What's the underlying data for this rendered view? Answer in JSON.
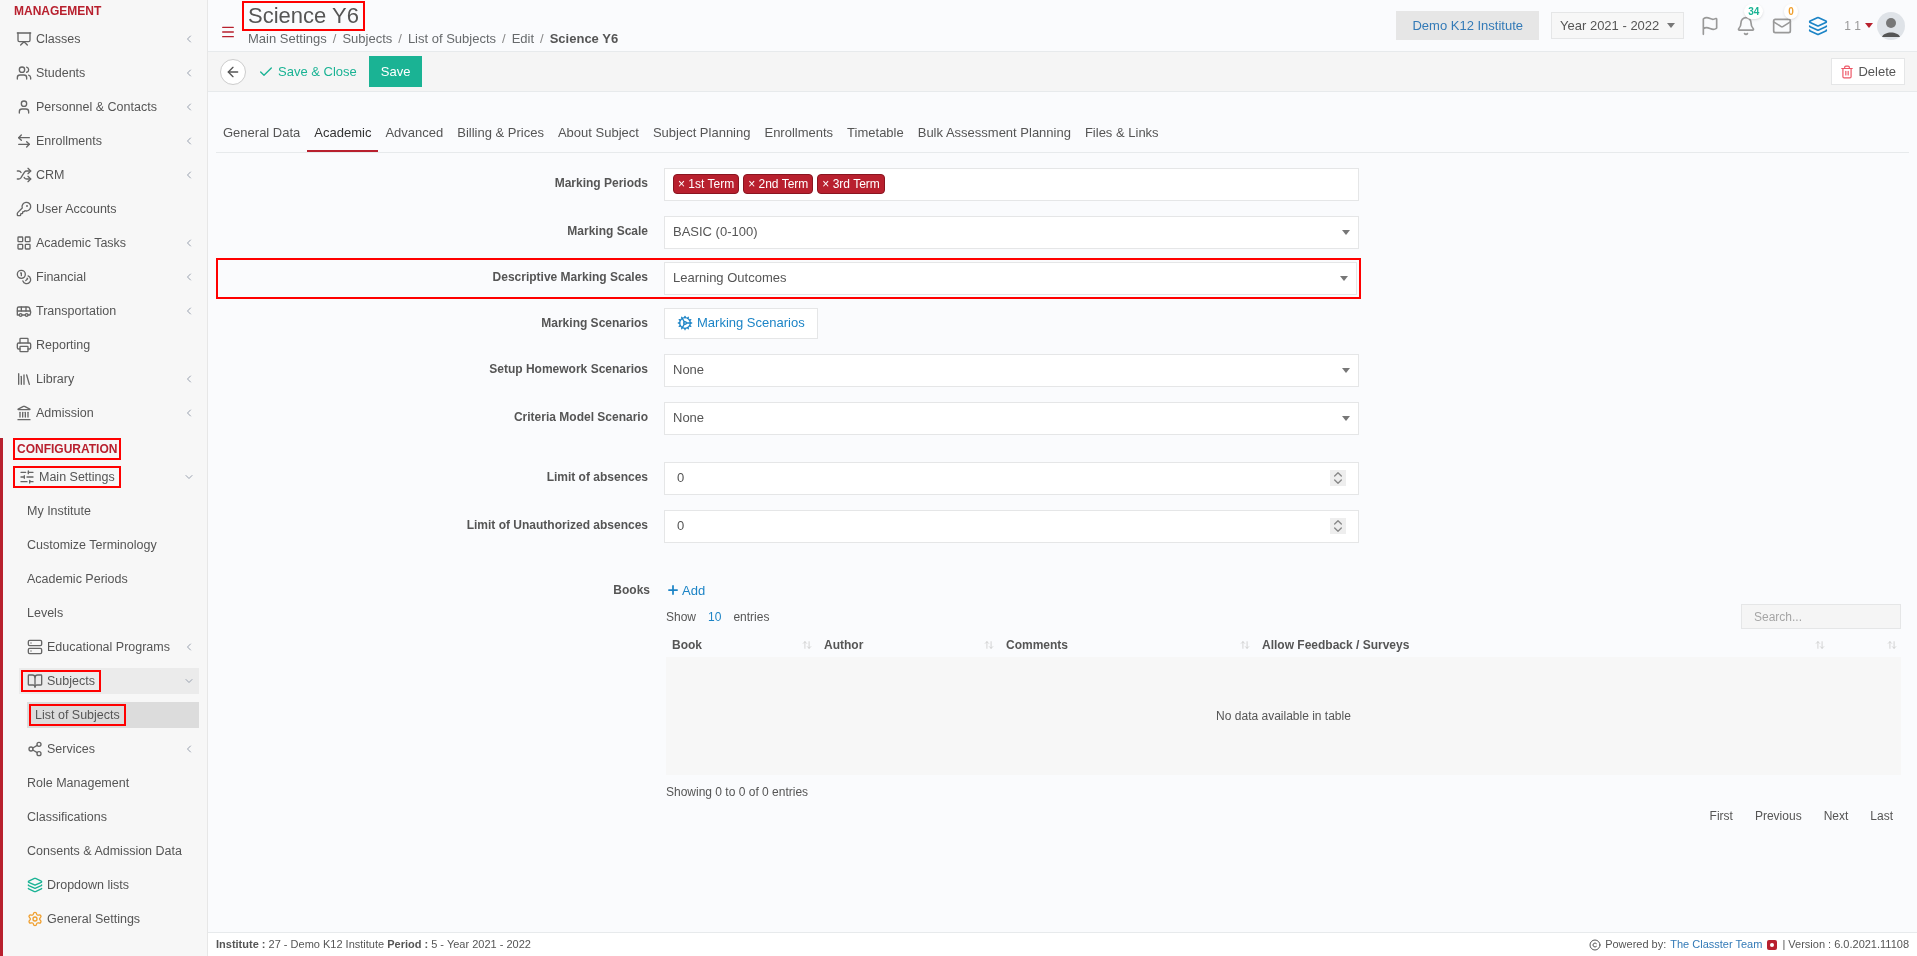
{
  "sidebar": {
    "sections": [
      {
        "heading": "MANAGEMENT",
        "highlighted": false,
        "items": [
          {
            "label": "Classes",
            "has_submenu": true,
            "expanded": false,
            "highlighted": false,
            "selected": false
          },
          {
            "label": "Students",
            "has_submenu": true,
            "expanded": false,
            "highlighted": false,
            "selected": false
          },
          {
            "label": "Personnel & Contacts",
            "has_submenu": true,
            "expanded": false,
            "highlighted": false,
            "selected": false
          },
          {
            "label": "Enrollments",
            "has_submenu": true,
            "expanded": false,
            "highlighted": false,
            "selected": false
          },
          {
            "label": "CRM",
            "has_submenu": true,
            "expanded": false,
            "highlighted": false,
            "selected": false
          },
          {
            "label": "User Accounts",
            "has_submenu": false,
            "highlighted": false,
            "selected": false
          },
          {
            "label": "Academic Tasks",
            "has_submenu": true,
            "expanded": false,
            "highlighted": false,
            "selected": false
          },
          {
            "label": "Financial",
            "has_submenu": true,
            "expanded": false,
            "highlighted": false,
            "selected": false
          },
          {
            "label": "Transportation",
            "has_submenu": true,
            "expanded": false,
            "highlighted": false,
            "selected": false
          },
          {
            "label": "Reporting",
            "has_submenu": false,
            "highlighted": false,
            "selected": false
          },
          {
            "label": "Library",
            "has_submenu": true,
            "expanded": false,
            "highlighted": false,
            "selected": false
          },
          {
            "label": "Admission",
            "has_submenu": true,
            "expanded": false,
            "highlighted": false,
            "selected": false
          }
        ]
      },
      {
        "heading": "CONFIGURATION",
        "highlighted": true,
        "items": [
          {
            "label": "Main Settings",
            "has_submenu": true,
            "expanded": true,
            "highlighted": true,
            "selected": false,
            "children": [
              {
                "label": "My Institute",
                "has_submenu": false,
                "highlighted": false,
                "selected": false
              },
              {
                "label": "Customize Terminology",
                "has_submenu": false,
                "highlighted": false,
                "selected": false
              },
              {
                "label": "Academic Periods",
                "has_submenu": false,
                "highlighted": false,
                "selected": false
              },
              {
                "label": "Levels",
                "has_submenu": false,
                "highlighted": false,
                "selected": false
              },
              {
                "label": "Educational Programs",
                "has_submenu": true,
                "expanded": false,
                "highlighted": false,
                "selected": false
              },
              {
                "label": "Subjects",
                "has_submenu": true,
                "expanded": true,
                "highlighted": true,
                "selected": false,
                "children": [
                  {
                    "label": "List of Subjects",
                    "has_submenu": false,
                    "highlighted": true,
                    "selected": true
                  }
                ]
              },
              {
                "label": "Services",
                "has_submenu": true,
                "expanded": false,
                "highlighted": false,
                "selected": false
              },
              {
                "label": "Role Management",
                "has_submenu": false,
                "highlighted": false,
                "selected": false
              },
              {
                "label": "Classifications",
                "has_submenu": false,
                "highlighted": false,
                "selected": false
              },
              {
                "label": "Consents & Admission Data",
                "has_submenu": false,
                "highlighted": false,
                "selected": false
              },
              {
                "label": "Dropdown lists",
                "has_submenu": false,
                "highlighted": false,
                "selected": false
              },
              {
                "label": "General Settings",
                "has_submenu": false,
                "highlighted": false,
                "selected": false
              }
            ]
          }
        ]
      }
    ]
  },
  "header": {
    "title": "Science Y6",
    "title_highlighted": true,
    "separator": "/",
    "breadcrumb": [
      {
        "label": "Main Settings",
        "current": false
      },
      {
        "label": "Subjects",
        "current": false
      },
      {
        "label": "List of Subjects",
        "current": false
      },
      {
        "label": "Edit",
        "current": false
      },
      {
        "label": "Science Y6",
        "current": true
      }
    ],
    "institute": "Demo K12 Institute",
    "year": "Year 2021 - 2022",
    "notifications": "34",
    "messages": "0",
    "user": "1 1"
  },
  "toolbar": {
    "save_close": "Save & Close",
    "save": "Save",
    "delete": "Delete"
  },
  "tabs": [
    {
      "label": "General Data",
      "selected": false
    },
    {
      "label": "Academic",
      "selected": true
    },
    {
      "label": "Advanced",
      "selected": false
    },
    {
      "label": "Billing & Prices",
      "selected": false
    },
    {
      "label": "About Subject",
      "selected": false
    },
    {
      "label": "Subject Planning",
      "selected": false
    },
    {
      "label": "Enrollments",
      "selected": false
    },
    {
      "label": "Timetable",
      "selected": false
    },
    {
      "label": "Bulk Assessment Planning",
      "selected": false
    },
    {
      "label": "Files & Links",
      "selected": false
    }
  ],
  "form": [
    {
      "kind": "tags",
      "label": "Marking Periods",
      "highlighted": false,
      "remove": "×",
      "tags": [
        "1st Term",
        "2nd Term",
        "3rd Term"
      ]
    },
    {
      "kind": "select",
      "label": "Marking Scale",
      "highlighted": false,
      "value": "BASIC (0-100)"
    },
    {
      "kind": "select",
      "label": "Descriptive Marking Scales",
      "highlighted": true,
      "value": "Learning Outcomes"
    },
    {
      "kind": "button",
      "label": "Marking Scenarios",
      "highlighted": false,
      "value": "Marking Scenarios"
    },
    {
      "kind": "select",
      "label": "Setup Homework Scenarios",
      "highlighted": false,
      "value": "None"
    },
    {
      "kind": "select",
      "label": "Criteria Model Scenario",
      "highlighted": false,
      "value": "None"
    },
    {
      "kind": "number",
      "label": "Limit of absences",
      "highlighted": false,
      "value": "0"
    },
    {
      "kind": "number",
      "label": "Limit of Unauthorized absences",
      "highlighted": false,
      "value": "0"
    }
  ],
  "books": {
    "label": "Books",
    "add": "Add",
    "show": "Show",
    "page_length": "10",
    "entries": "entries",
    "search_placeholder": "Search...",
    "columns": [
      "Book",
      "Author",
      "Comments",
      "Allow Feedback / Surveys"
    ],
    "empty": "No data available in table",
    "info": "Showing 0 to 0 of 0 entries",
    "pagination": [
      "First",
      "Previous",
      "Next",
      "Last"
    ]
  },
  "footer": {
    "institute": "**Institute :** 27 - Demo K12 Institute **Period :** 5 - Year 2021 - 2022",
    "powered": "Powered by:",
    "team": "The Classter Team",
    "version": "| Version : 6.0.2021.11108"
  }
}
